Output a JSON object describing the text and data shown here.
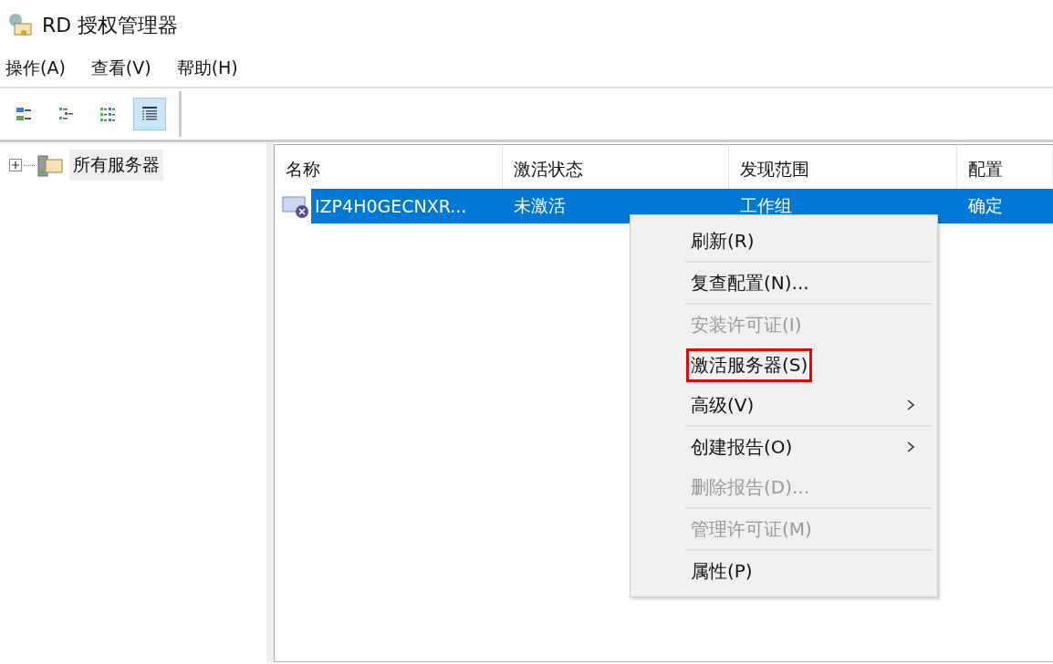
{
  "window": {
    "title": "RD 授权管理器"
  },
  "menu_bar": [
    {
      "label": "操作(A)"
    },
    {
      "label": "查看(V)"
    },
    {
      "label": "帮助(H)"
    }
  ],
  "toolbar": [
    {
      "kind": "large-icons",
      "selected": false
    },
    {
      "kind": "small-icons",
      "selected": false
    },
    {
      "kind": "list",
      "selected": false
    },
    {
      "kind": "details",
      "selected": true
    }
  ],
  "tree": {
    "items": [
      {
        "label": "所有服务器",
        "expanded": false,
        "selected": true
      }
    ]
  },
  "table": {
    "columns": [
      "名称",
      "激活状态",
      "发现范围",
      "配置"
    ],
    "rows": [
      {
        "cells": [
          "IZP4H0GECNXR...",
          "未激活",
          "工作组",
          "确定"
        ],
        "selected": true,
        "activated": false
      }
    ]
  },
  "context_menu": {
    "items": [
      {
        "kind": "item",
        "label": "刷新(R)",
        "disabled": false,
        "submenu": false,
        "highlighted": false
      },
      {
        "kind": "separator"
      },
      {
        "kind": "item",
        "label": "复查配置(N)...",
        "disabled": false,
        "submenu": false,
        "highlighted": false
      },
      {
        "kind": "separator"
      },
      {
        "kind": "item",
        "label": "安装许可证(I)",
        "disabled": true,
        "submenu": false,
        "highlighted": false
      },
      {
        "kind": "item",
        "label": "激活服务器(S)",
        "disabled": false,
        "submenu": false,
        "highlighted": true
      },
      {
        "kind": "item",
        "label": "高级(V)",
        "disabled": false,
        "submenu": true,
        "highlighted": false
      },
      {
        "kind": "separator"
      },
      {
        "kind": "item",
        "label": "创建报告(O)",
        "disabled": false,
        "submenu": true,
        "highlighted": false
      },
      {
        "kind": "item",
        "label": "删除报告(D)...",
        "disabled": true,
        "submenu": false,
        "highlighted": false
      },
      {
        "kind": "separator"
      },
      {
        "kind": "item",
        "label": "管理许可证(M)",
        "disabled": true,
        "submenu": false,
        "highlighted": false
      },
      {
        "kind": "separator"
      },
      {
        "kind": "item",
        "label": "属性(P)",
        "disabled": false,
        "submenu": false,
        "highlighted": false
      }
    ]
  }
}
